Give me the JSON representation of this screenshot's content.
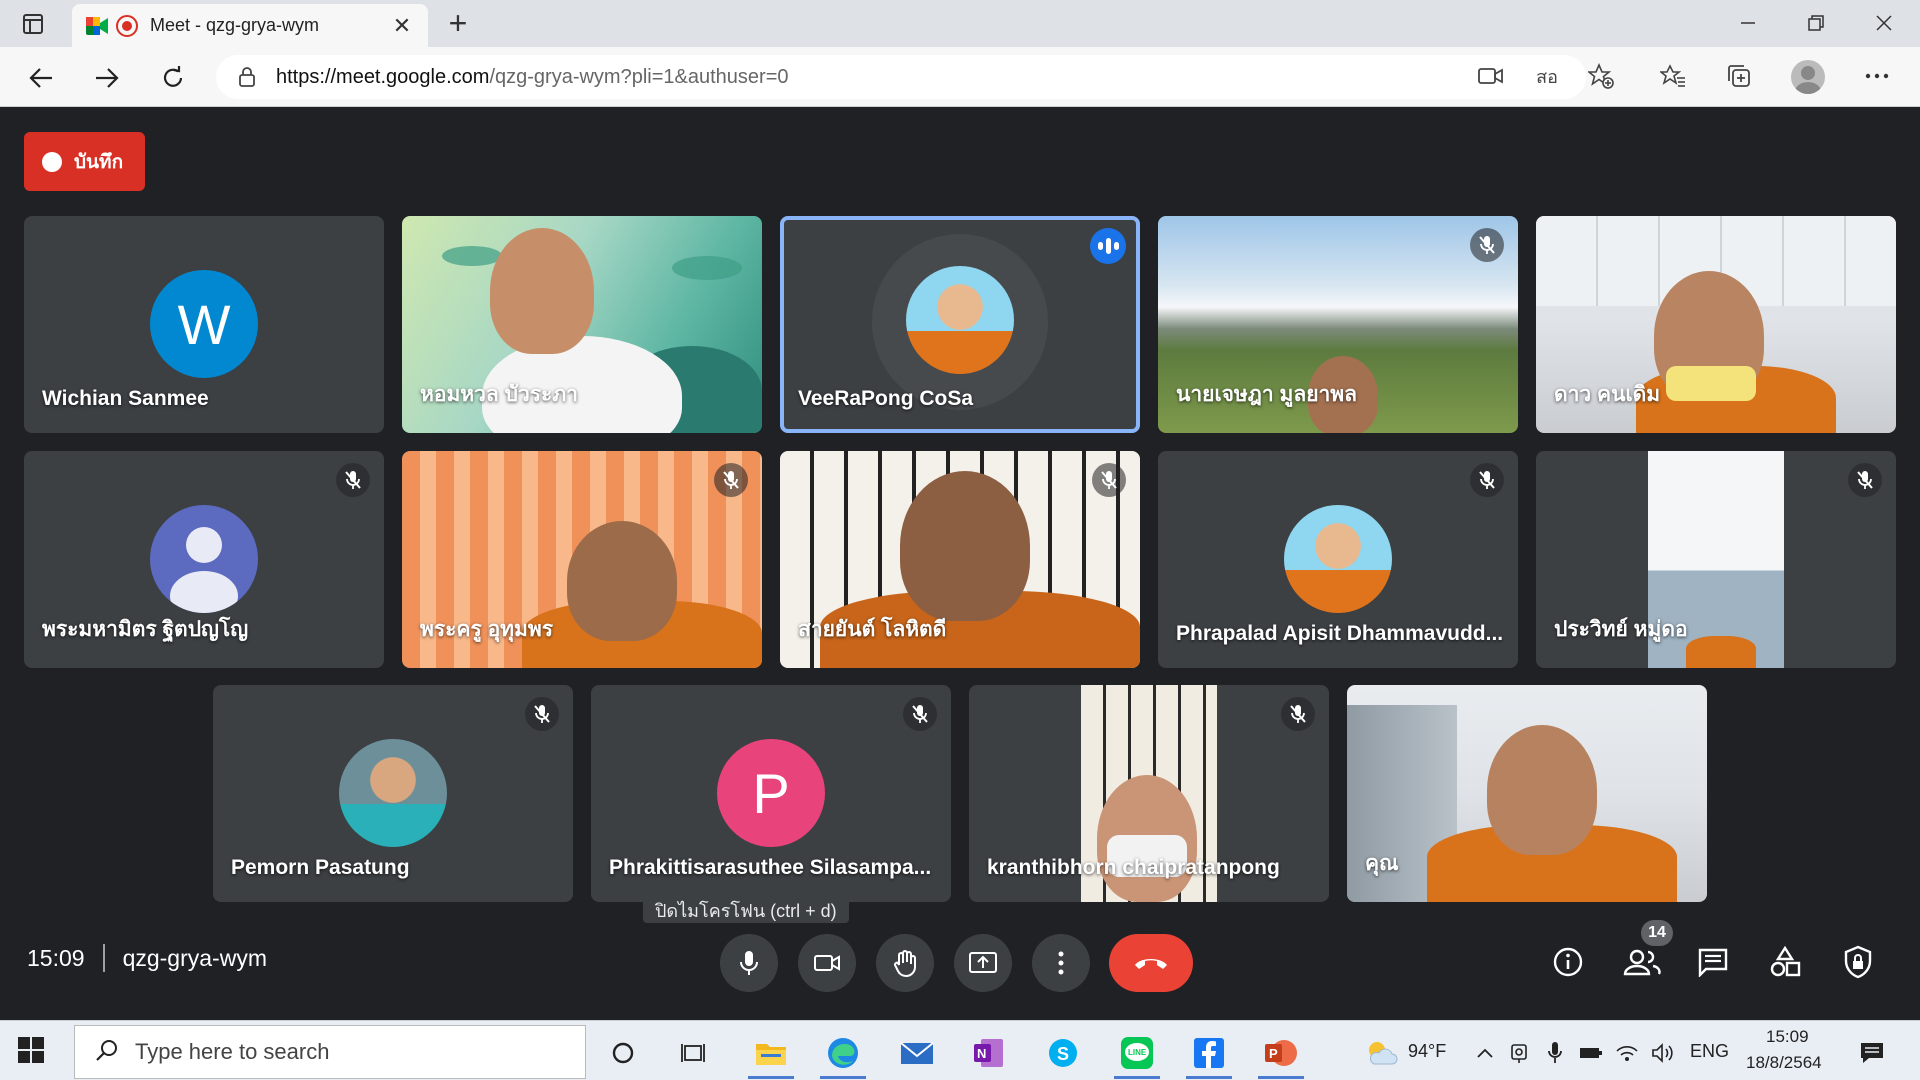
{
  "browser": {
    "tab_title": "Meet - qzg-grya-wym",
    "url_host": "https://meet.google.com",
    "url_path": "/qzg-grya-wym?pli=1&authuser=0",
    "translate_icon_label": "สอ",
    "close_tab_glyph": "✕",
    "new_tab_glyph": "+"
  },
  "meet": {
    "recording_label": "บันทึก",
    "time": "15:09",
    "meeting_code": "qzg-grya-wym",
    "tooltip": "ปิดไมโครโฟน (ctrl + d)",
    "participant_count": "14",
    "participants": [
      {
        "name": "Wichian Sanmee",
        "initial": "W",
        "avatar_color": "#0288d1",
        "muted": false
      },
      {
        "name": "หอมหวล บัวระภา",
        "muted": false
      },
      {
        "name": "VeeRaPong CoSa",
        "muted": false,
        "speaking": true
      },
      {
        "name": "นายเจษฎา มูลยาพล",
        "muted": true
      },
      {
        "name": "ดาว คนเดิม",
        "muted": false
      },
      {
        "name": "พระมหามิตร ฐิตปญโญ",
        "muted": true
      },
      {
        "name": "พระครู อุทุมพร",
        "muted": true
      },
      {
        "name": "สายยันต์ โลหิตดี",
        "muted": true
      },
      {
        "name": "Phrapalad Apisit Dhammavudd...",
        "muted": true
      },
      {
        "name": "ประวิทย์ หมู่ดอ",
        "muted": true
      },
      {
        "name": "Pemorn Pasatung",
        "muted": true
      },
      {
        "name": "Phrakittisarasuthee Silasampa...",
        "initial": "P",
        "avatar_color": "#e8437a",
        "muted": true
      },
      {
        "name": "kranthibhorn chaipratanpong",
        "muted": true
      },
      {
        "name": "คุณ",
        "muted": false
      }
    ]
  },
  "taskbar": {
    "search_placeholder": "Type here to search",
    "weather": "94°F",
    "language": "ENG",
    "time": "15:09",
    "date": "18/8/2564"
  },
  "colors": {
    "meet_bg": "#202124",
    "tile_bg": "#3c4043",
    "record_red": "#d93025",
    "end_call_red": "#ea4335",
    "active_border": "#8ab4f8"
  }
}
